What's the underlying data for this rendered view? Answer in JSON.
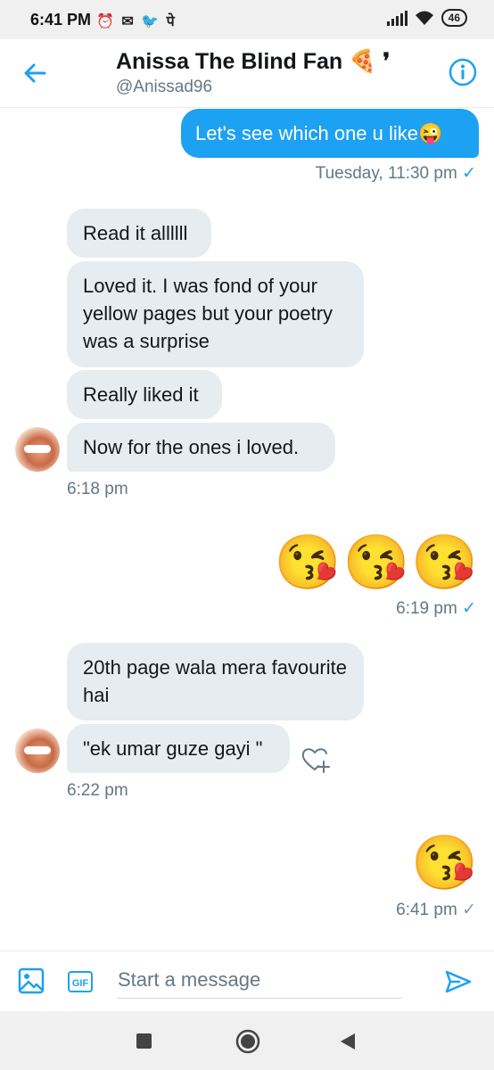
{
  "status": {
    "time": "6:41 PM",
    "notif": "⏰ ✉ 🐦 पे",
    "battery": "46"
  },
  "header": {
    "name": "Anissa The Blind Fan 🍕 ❜",
    "handle": "@Anissad96"
  },
  "messages": {
    "m1": "Let's see which one u like😜",
    "m1_time": "Tuesday, 11:30 pm",
    "m2": "Read it allllll",
    "m3": "Loved it. I was fond of your yellow pages but your poetry was a surprise",
    "m4": "Really liked it",
    "m5": "Now for the ones i loved.",
    "m5_time": "6:18 pm",
    "m6_emoji": "😘😘😘",
    "m6_time": "6:19 pm",
    "m7": "20th page wala mera favourite hai",
    "m8": "\"ek umar guze gayi \"",
    "m8_time": "6:22 pm",
    "m9_emoji": "😘",
    "m9_time": "6:41 pm",
    "check": "✓"
  },
  "compose": {
    "placeholder": "Start a message",
    "gif_label": "GIF"
  },
  "colors": {
    "accent": "#1da1f2",
    "incoming_bg": "#e6ecf0",
    "muted": "#657786"
  }
}
